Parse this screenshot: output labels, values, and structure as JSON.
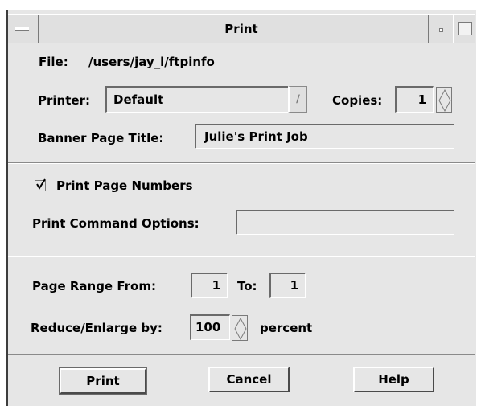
{
  "window": {
    "title": "Print"
  },
  "file": {
    "label": "File:",
    "path": "/users/jay_l/ftpinfo"
  },
  "printer": {
    "label": "Printer:",
    "value": "Default"
  },
  "copies": {
    "label": "Copies:",
    "value": "1"
  },
  "banner": {
    "label": "Banner Page Title:",
    "value": "Julie's Print Job"
  },
  "page_numbers": {
    "label": "Print Page Numbers",
    "checked": true
  },
  "command_options": {
    "label": "Print Command Options:",
    "value": ""
  },
  "page_range": {
    "from_label": "Page Range From:",
    "from_value": "1",
    "to_label": "To:",
    "to_value": "1"
  },
  "scale": {
    "label": "Reduce/Enlarge by:",
    "value": "100",
    "unit": "percent"
  },
  "buttons": {
    "print": "Print",
    "cancel": "Cancel",
    "help": "Help"
  }
}
